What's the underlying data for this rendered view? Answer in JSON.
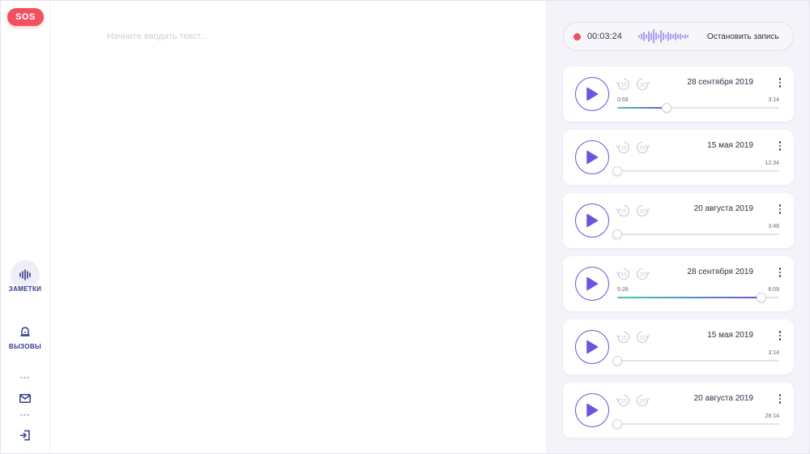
{
  "rail": {
    "sos_label": "SOS",
    "nav": [
      {
        "label": "ЗАМЕТКИ",
        "icon": "waveform-icon",
        "active": true
      },
      {
        "label": "ВЫЗОВЫ",
        "icon": "siren-icon",
        "active": false
      }
    ],
    "bottom_icons": [
      "mail-icon",
      "logout-icon"
    ]
  },
  "editor": {
    "placeholder": "Начните вводить текст..."
  },
  "recording": {
    "time": "00:03:24",
    "stop_label": "Остановить запись"
  },
  "skip_label": "15",
  "recordings": [
    {
      "date": "28 сентября 2019",
      "current": "0:59",
      "total": "3:14",
      "progress": 0.3041
    },
    {
      "date": "15 мая 2019",
      "current": "",
      "total": "12:34",
      "progress": 0
    },
    {
      "date": "20 августа 2019",
      "current": "",
      "total": "3:48",
      "progress": 0
    },
    {
      "date": "28 сентября 2019",
      "current": "5:28",
      "total": "6:09",
      "progress": 0.8889
    },
    {
      "date": "15 мая 2019",
      "current": "",
      "total": "3:14",
      "progress": 0
    },
    {
      "date": "20 августа 2019",
      "current": "",
      "total": "28:14",
      "progress": 0
    }
  ],
  "colors": {
    "accent": "#6a54e0",
    "sos": "#ef5160",
    "progress_start": "#40d0a8",
    "progress_end": "#6a54e0",
    "panel_bg": "#f3f3f9"
  }
}
